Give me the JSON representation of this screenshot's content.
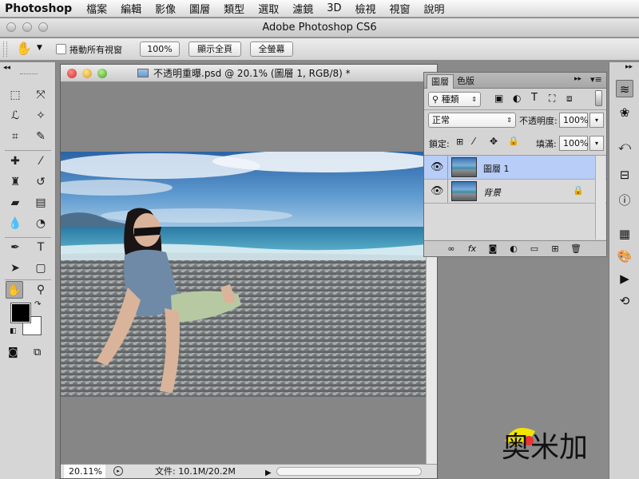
{
  "menubar": {
    "app": "Photoshop",
    "items": [
      "檔案",
      "編輯",
      "影像",
      "圖層",
      "類型",
      "選取",
      "濾鏡",
      "3D",
      "檢視",
      "視窗",
      "說明"
    ]
  },
  "window": {
    "title": "Adobe Photoshop CS6"
  },
  "options_bar": {
    "scroll_all_label": "捲動所有視窗",
    "zoom_100": "100%",
    "fit_screen": "顯示全頁",
    "fill_screen": "全螢幕"
  },
  "tools": {
    "selected": "hand-tool"
  },
  "document": {
    "title": "不透明重曝.psd @ 20.1% (圖層 1, RGB/8) *",
    "zoom": "20.11%",
    "doc_size": "文件: 10.1M/20.2M"
  },
  "layers_panel": {
    "tabs": [
      "圖層",
      "色版"
    ],
    "filter_kind": "種類",
    "blend_mode": "正常",
    "opacity_label": "不透明度:",
    "opacity_value": "100%",
    "lock_label": "鎖定:",
    "fill_label": "填滿:",
    "fill_value": "100%",
    "layers": [
      {
        "name": "圖層 1",
        "visible": true,
        "selected": true,
        "locked": false
      },
      {
        "name": "背景",
        "visible": true,
        "selected": false,
        "locked": true
      }
    ]
  },
  "watermark": "奥米加",
  "colors": {
    "selected_layer": "#b8cdf7",
    "sky_top": "#2f6fb3",
    "sea": "#3f9fc0",
    "foreground": "#000000",
    "background": "#ffffff"
  }
}
